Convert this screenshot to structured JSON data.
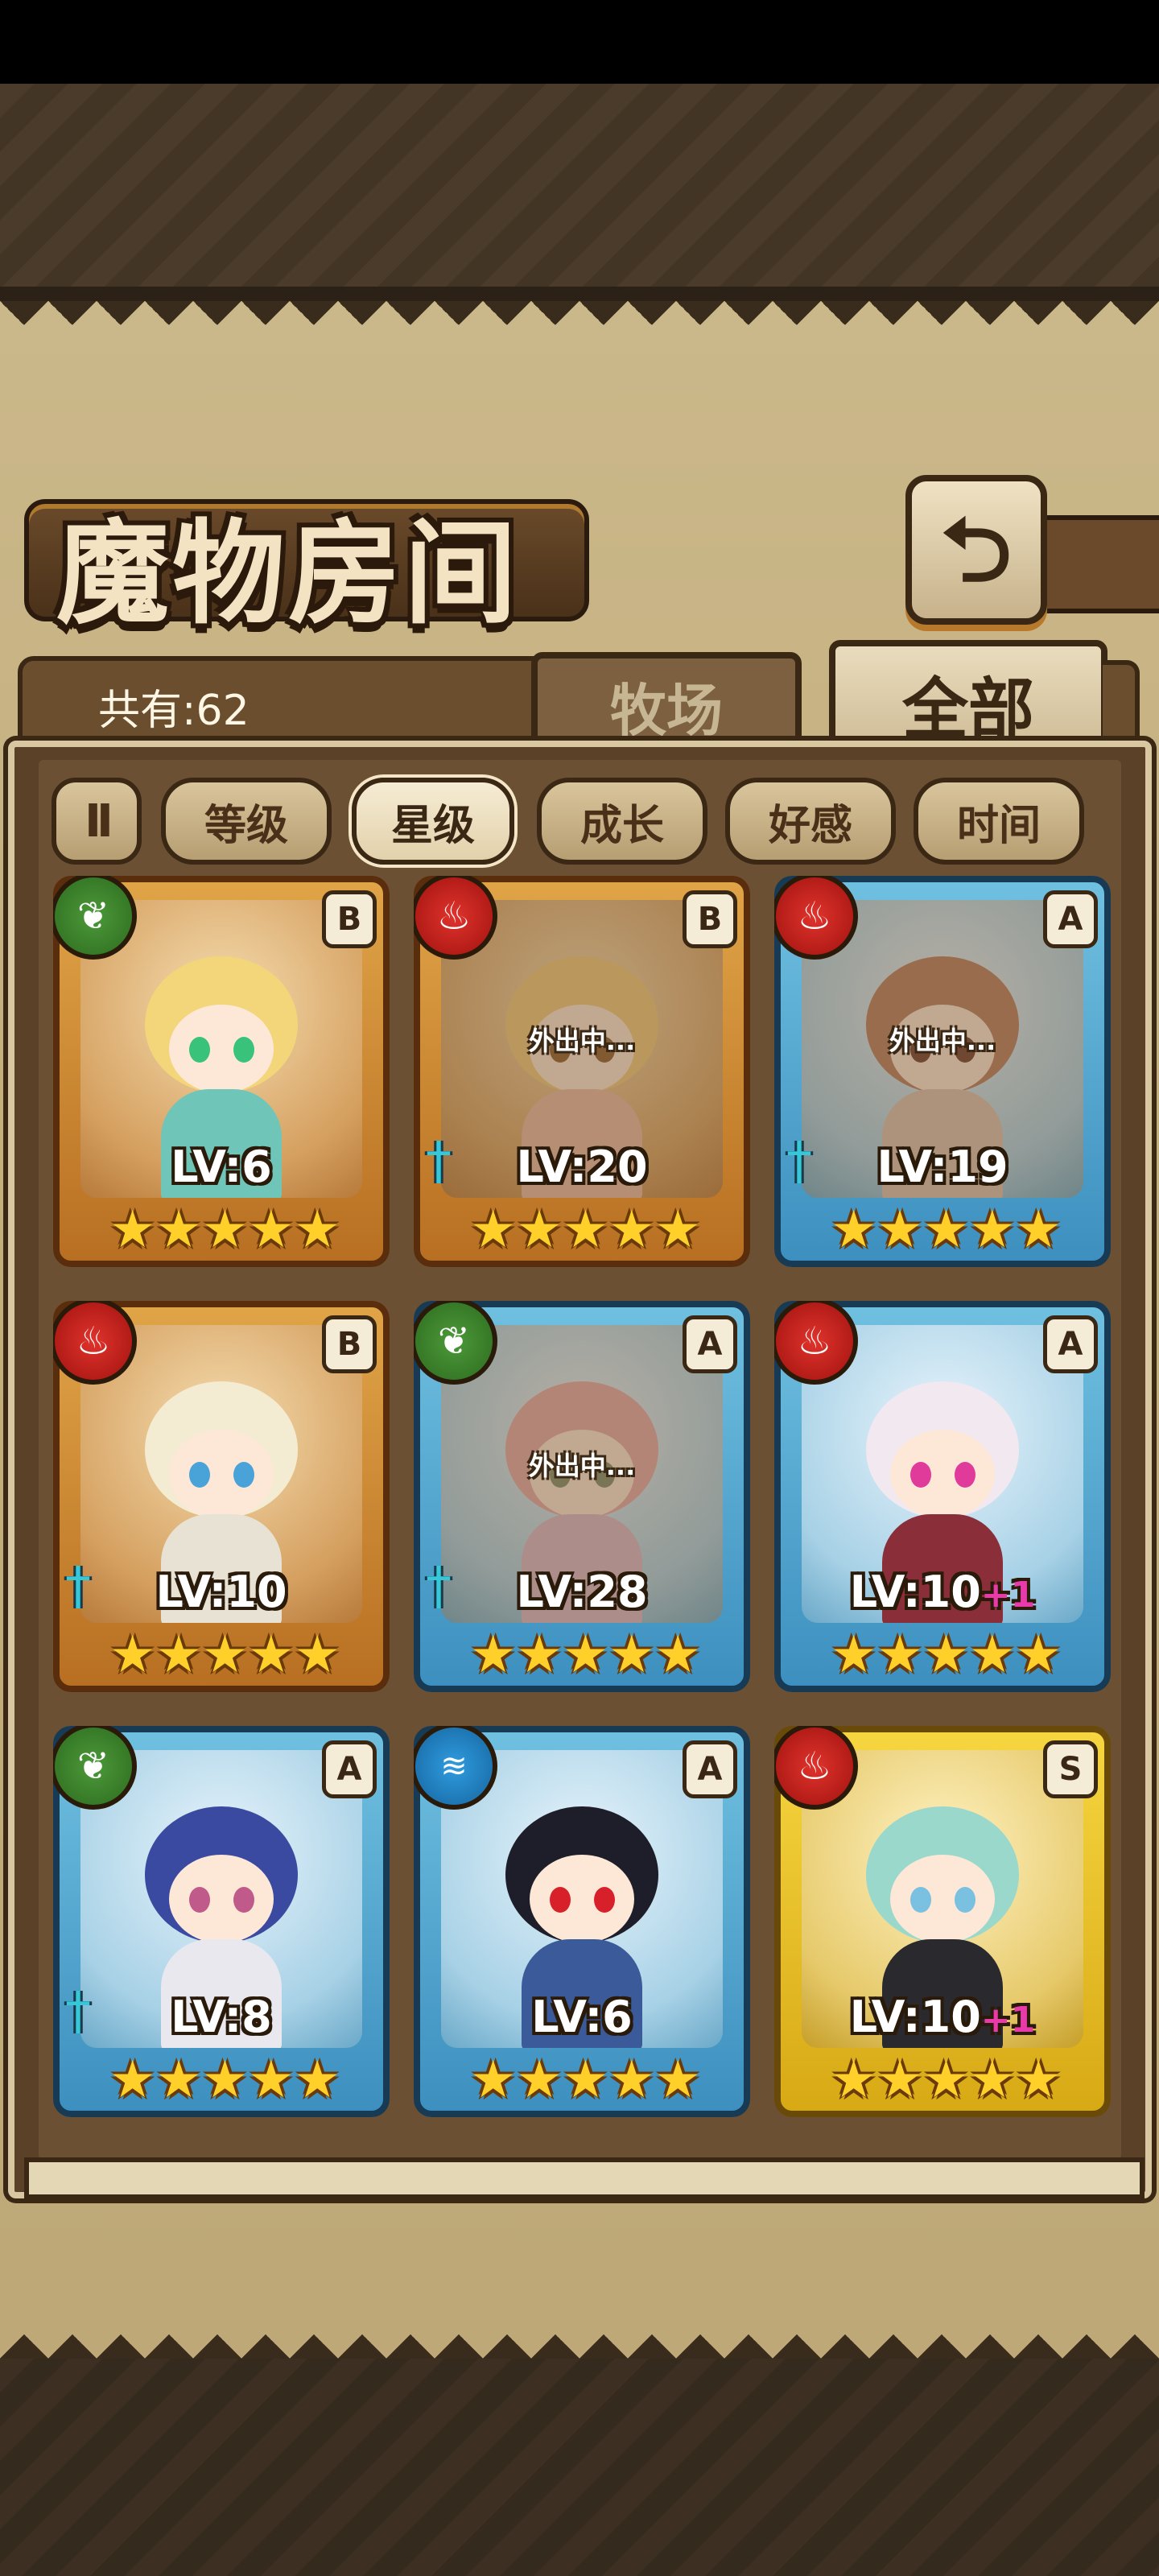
{
  "header": {
    "title": "魔物房间",
    "back_icon": "back-arrow-icon",
    "back_glyph": "⮌"
  },
  "tabs": {
    "count_label": "共有:62",
    "pasture": "牧场",
    "all": "全部"
  },
  "sort": {
    "pause_glyph": "II",
    "buttons": [
      "等级",
      "星级",
      "成长",
      "好感",
      "时间"
    ],
    "active": "星级"
  },
  "cards": [
    {
      "element": "leaf",
      "element_glyph": "❦",
      "rank": "B",
      "frame": "gold",
      "level": "LV:6",
      "plus": "",
      "stars": 5,
      "away": false,
      "away_text": "",
      "sword": false,
      "hair": "#f3d57a",
      "body": "#6ec5b8",
      "eyes": "#39c27a"
    },
    {
      "element": "fire",
      "element_glyph": "♨",
      "rank": "B",
      "frame": "gold",
      "level": "LV:20",
      "plus": "",
      "stars": 5,
      "away": true,
      "away_text": "外出中...",
      "sword": true,
      "hair": "#f0c878",
      "body": "#e7b8a0",
      "eyes": "#8a5a2a"
    },
    {
      "element": "fire",
      "element_glyph": "♨",
      "rank": "A",
      "frame": "blue",
      "level": "LV:19",
      "plus": "",
      "stars": 5,
      "away": true,
      "away_text": "外出中...",
      "sword": true,
      "hair": "#b57a5e",
      "body": "#d9c2b0",
      "eyes": "#6a3a2a"
    },
    {
      "element": "fire",
      "element_glyph": "♨",
      "rank": "B",
      "frame": "gold",
      "level": "LV:10",
      "plus": "",
      "stars": 5,
      "away": false,
      "away_text": "",
      "sword": true,
      "hair": "#f4ecd2",
      "body": "#e8e2d4",
      "eyes": "#4aa3d8"
    },
    {
      "element": "leaf",
      "element_glyph": "❦",
      "rank": "A",
      "frame": "blue",
      "level": "LV:28",
      "plus": "",
      "stars": 5,
      "away": true,
      "away_text": "外出中...",
      "sword": true,
      "hair": "#e4a8a8",
      "body": "#d8b6c8",
      "eyes": "#7a8a6a"
    },
    {
      "element": "fire",
      "element_glyph": "♨",
      "rank": "A",
      "frame": "blue",
      "level": "LV:10",
      "plus": "+1",
      "stars": 5,
      "away": false,
      "away_text": "",
      "sword": false,
      "hair": "#f2e8f0",
      "body": "#8a2f3a",
      "eyes": "#e03a9a"
    },
    {
      "element": "leaf",
      "element_glyph": "❦",
      "rank": "A",
      "frame": "blue",
      "level": "LV:8",
      "plus": "",
      "stars": 5,
      "away": false,
      "away_text": "",
      "sword": true,
      "hair": "#3a4aa0",
      "body": "#e8e8ee",
      "eyes": "#c05a8a"
    },
    {
      "element": "water",
      "element_glyph": "≋",
      "rank": "A",
      "frame": "blue",
      "level": "LV:6",
      "plus": "",
      "stars": 5,
      "away": false,
      "away_text": "",
      "sword": false,
      "hair": "#1e1e2a",
      "body": "#3a5a9a",
      "eyes": "#d8202a"
    },
    {
      "element": "fire",
      "element_glyph": "♨",
      "rank": "S",
      "frame": "yellow",
      "level": "LV:10",
      "plus": "+1",
      "stars": 5,
      "away": false,
      "away_text": "",
      "sword": false,
      "hair": "#9ad8cc",
      "body": "#2a2a2e",
      "eyes": "#7ac0e0"
    }
  ],
  "star_glyph": "★"
}
